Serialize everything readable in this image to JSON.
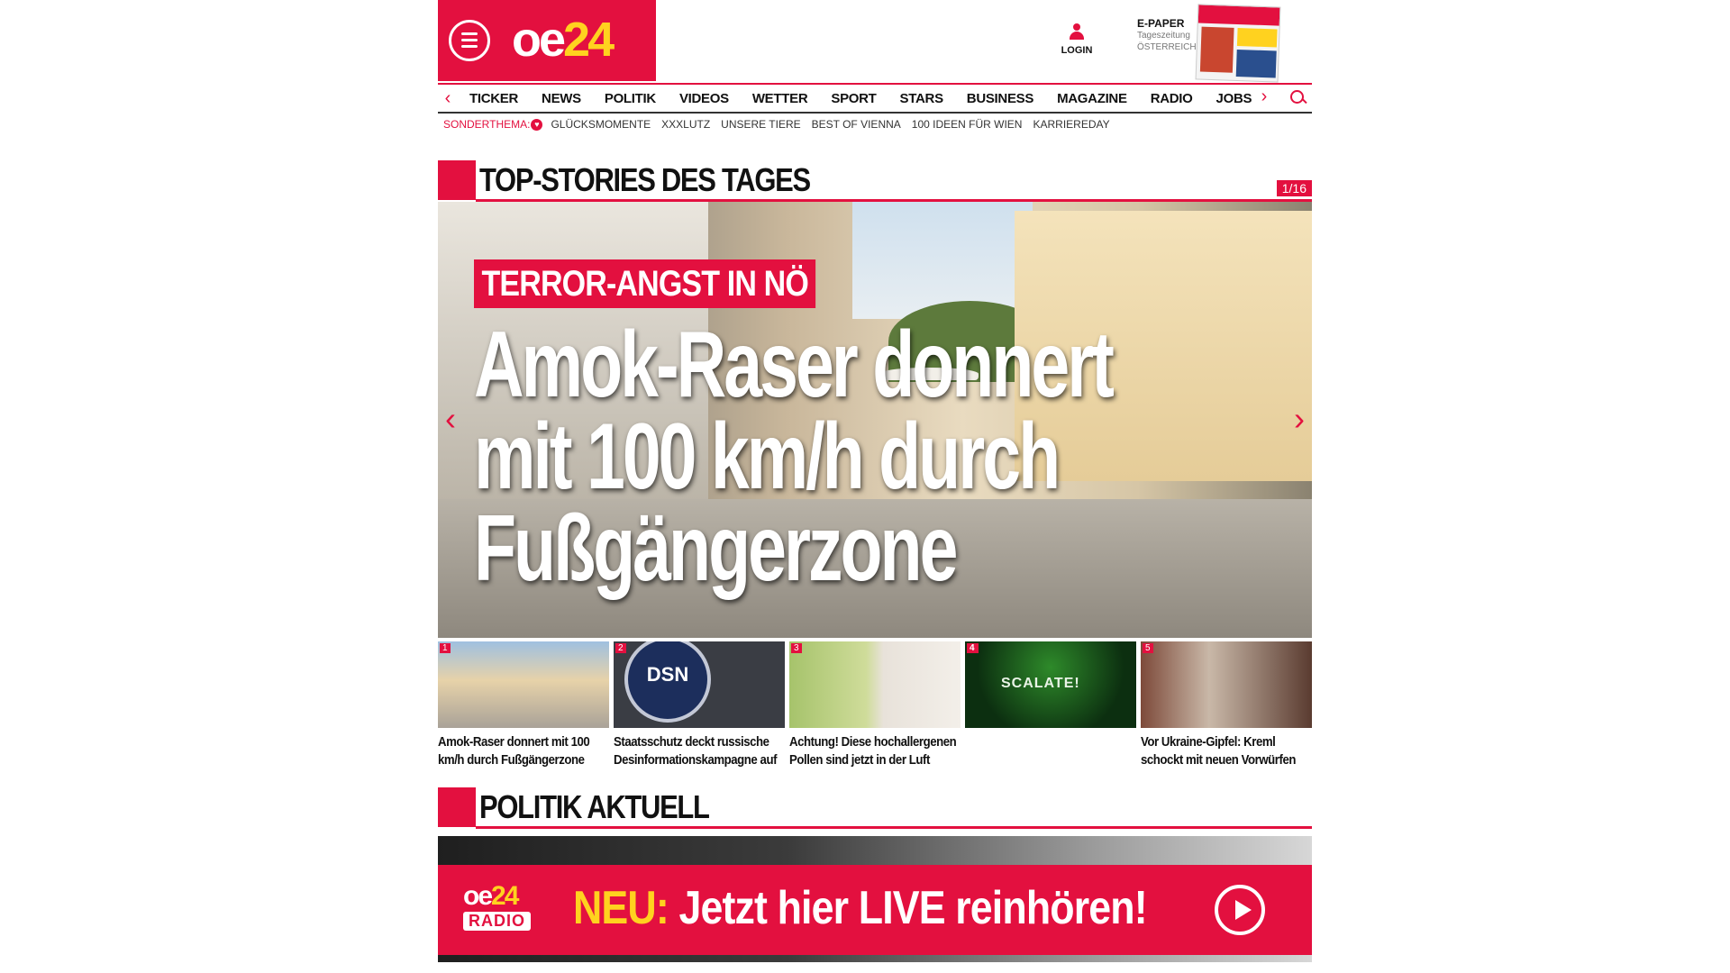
{
  "header": {
    "brand_oe": "oe",
    "brand_num": "24",
    "login_label": "LOGIN",
    "epaper_title": "E-PAPER",
    "epaper_sub1": "Tageszeitung",
    "epaper_sub2": "ÖSTERREICH"
  },
  "nav": {
    "items": [
      "TICKER",
      "NEWS",
      "POLITIK",
      "VIDEOS",
      "WETTER",
      "SPORT",
      "STARS",
      "BUSINESS",
      "MAGAZINE",
      "RADIO",
      "JOBS"
    ]
  },
  "subnav": {
    "label": "SONDERTHEMA:",
    "items": [
      "GLÜCKSMOMENTE",
      "XXXLUTZ",
      "UNSERE TIERE",
      "BEST OF VIENNA",
      "100 IDEEN FÜR WIEN",
      "KARRIEREDAY"
    ]
  },
  "top_stories": {
    "title": "TOP-STORIES DES TAGES",
    "counter": "1/16",
    "hero": {
      "kicker": "TERROR-ANGST IN NÖ",
      "headline": "Amok-Raser donnert mit 100 km/h durch Fußgängerzone"
    },
    "teasers": [
      {
        "num": "1",
        "title": "Amok-Raser donnert mit 100 km/h durch Fußgängerzone"
      },
      {
        "num": "2",
        "title": "Staatsschutz deckt russische Desinformationskampagne auf"
      },
      {
        "num": "3",
        "title": "Achtung! Diese hochallergenen Pollen sind jetzt in der Luft"
      },
      {
        "num": "4",
        "title": ""
      },
      {
        "num": "5",
        "title": "Vor Ukraine-Gipfel: Kreml schockt mit neuen Vorwürfen"
      }
    ],
    "thumb2_text": "DSN",
    "thumb4_text": "SCALATE!"
  },
  "politik": {
    "title": "POLITIK AKTUELL"
  },
  "radio_banner": {
    "logo_oe": "oe",
    "logo_num": "24",
    "logo_radio": "RADIO",
    "neu": "NEU:",
    "message": "Jetzt hier LIVE reinhören!"
  },
  "colors": {
    "brand_red": "#e3103f",
    "accent_yellow": "#ffd21f"
  }
}
